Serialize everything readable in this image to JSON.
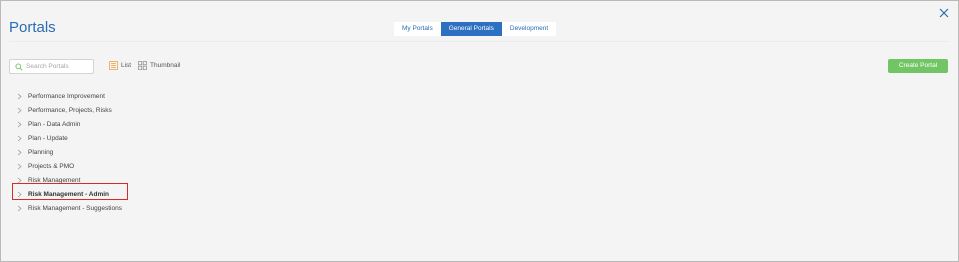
{
  "header": {
    "title": "Portals",
    "tabs": [
      {
        "label": "My Portals",
        "active": false
      },
      {
        "label": "General Portals",
        "active": true
      },
      {
        "label": "Development",
        "active": false
      }
    ]
  },
  "toolbar": {
    "search_placeholder": "Search Portals",
    "view_list_label": "List",
    "view_thumbnail_label": "Thumbnail",
    "create_label": "Create Portal"
  },
  "portals": {
    "items": [
      {
        "label": "Performance Improvement"
      },
      {
        "label": "Performance, Projects, Risks"
      },
      {
        "label": "Plan - Data Admin"
      },
      {
        "label": "Plan - Update"
      },
      {
        "label": "Planning"
      },
      {
        "label": "Projects & PMO"
      },
      {
        "label": "Risk Management"
      },
      {
        "label": "Risk Management - Admin",
        "highlighted": true
      },
      {
        "label": "Risk Management - Suggestions"
      }
    ]
  },
  "colors": {
    "accent_blue": "#2d6fc0",
    "create_green": "#72c565",
    "highlight_red": "#d62b2b",
    "list_icon_orange": "#f0a14a"
  },
  "icons": {
    "close": "close-icon",
    "search": "search-icon",
    "list": "list-view-icon",
    "thumbnail": "thumbnail-view-icon",
    "expand": "chevron-right-icon"
  }
}
